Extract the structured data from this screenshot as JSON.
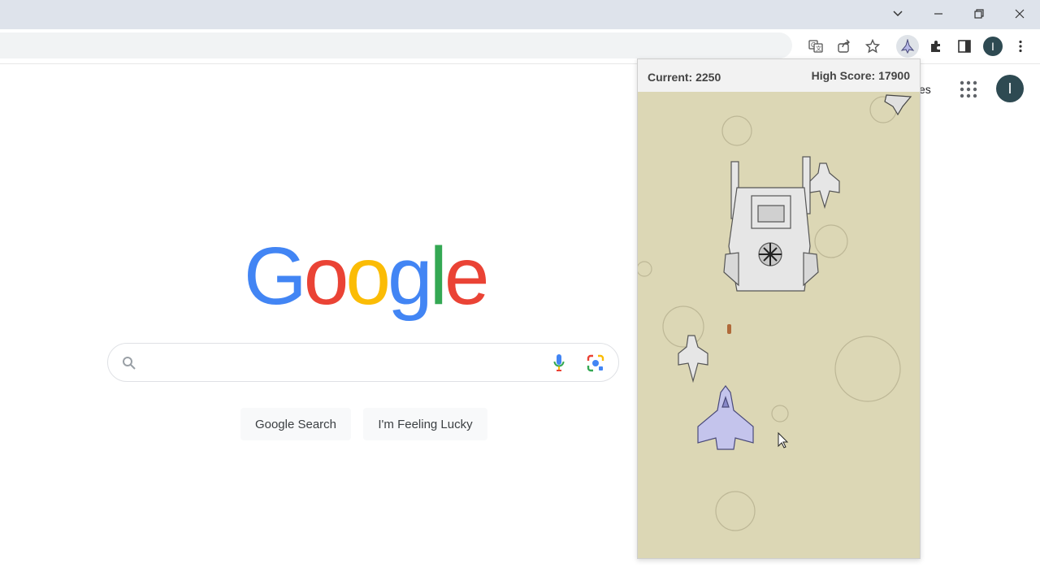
{
  "window": {
    "controls": [
      "chevron-down",
      "minimize",
      "restore",
      "close"
    ]
  },
  "toolbar": {
    "icons": [
      "translate-icon",
      "share-icon",
      "bookmark-star-icon",
      "game-extension-icon",
      "extensions-puzzle-icon",
      "side-panel-icon",
      "profile-avatar",
      "more-menu-icon"
    ],
    "profile_initial": "I"
  },
  "google": {
    "logo_letters": [
      "G",
      "o",
      "o",
      "g",
      "l",
      "e"
    ],
    "logo_colors": [
      "#4285f4",
      "#ea4335",
      "#fbbc05",
      "#4285f4",
      "#34a853",
      "#ea4335"
    ],
    "search_placeholder": "",
    "search_button": "Google Search",
    "lucky_button": "I'm Feeling Lucky",
    "top_right_partial_link": "es",
    "account_initial": "I"
  },
  "popup": {
    "current_score": "Current: 2250",
    "high_score": "High Score: 17900",
    "game_background": "#dcd7b5"
  }
}
